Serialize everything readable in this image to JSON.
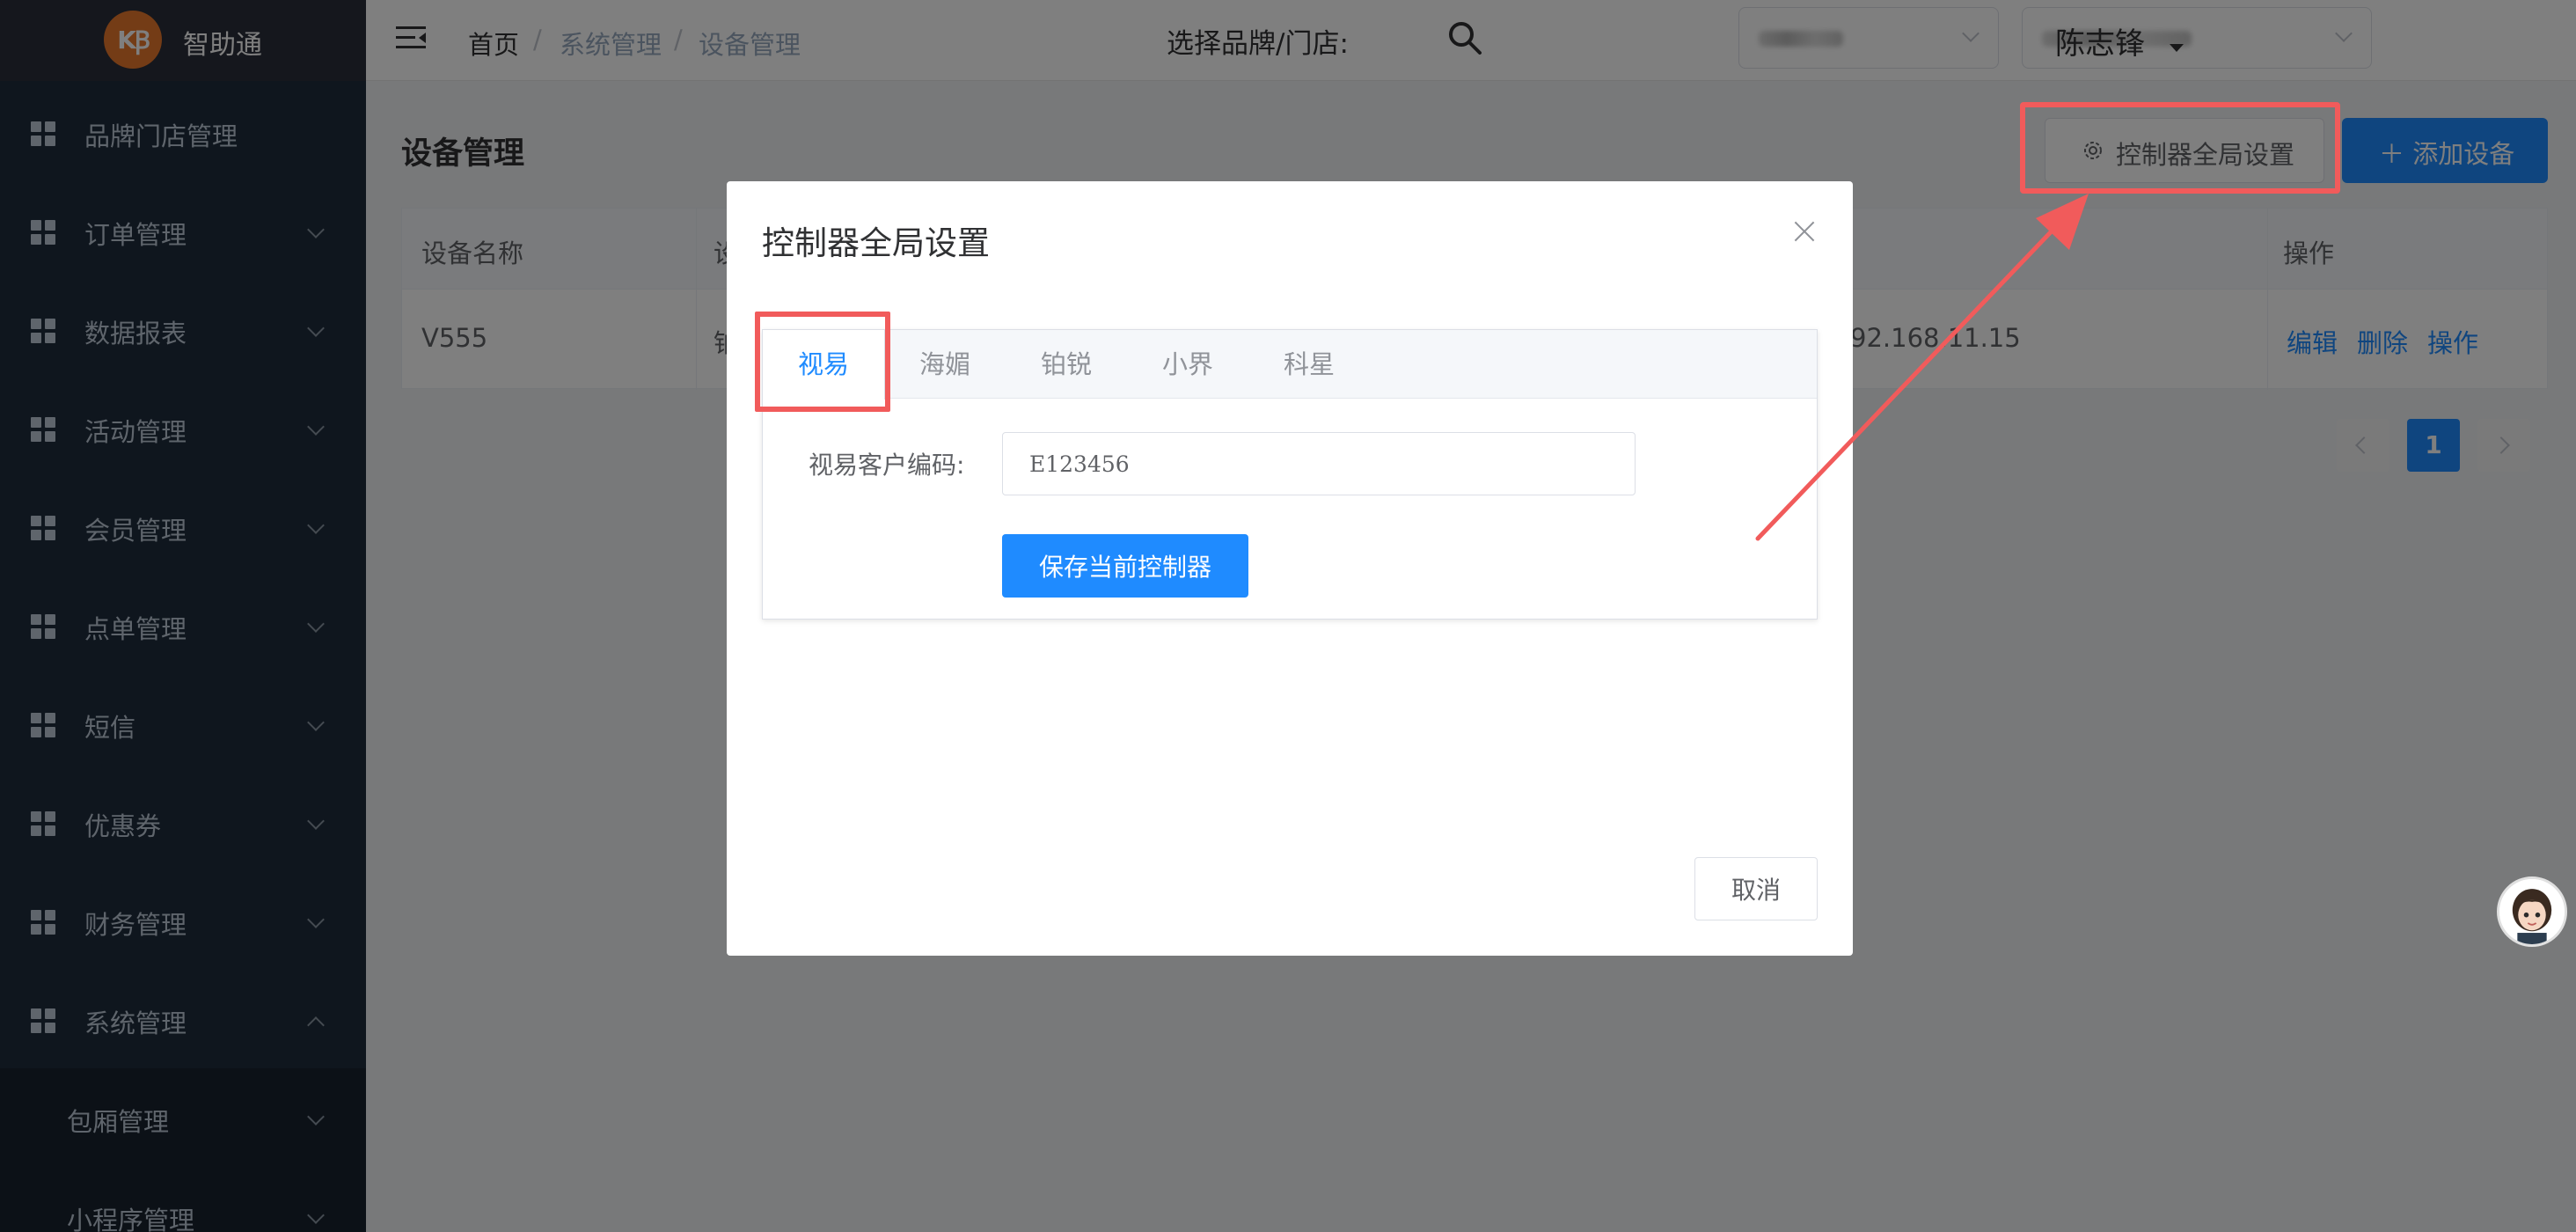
{
  "app": {
    "logo_text": "KꞴ",
    "name": "智助通"
  },
  "sidebar": {
    "items": [
      {
        "label": "品牌门店管理",
        "has_chevron": false
      },
      {
        "label": "订单管理",
        "has_chevron": true
      },
      {
        "label": "数据报表",
        "has_chevron": true
      },
      {
        "label": "活动管理",
        "has_chevron": true
      },
      {
        "label": "会员管理",
        "has_chevron": true
      },
      {
        "label": "点单管理",
        "has_chevron": true
      },
      {
        "label": "短信",
        "has_chevron": true
      },
      {
        "label": "优惠券",
        "has_chevron": true
      },
      {
        "label": "财务管理",
        "has_chevron": true
      },
      {
        "label": "系统管理",
        "has_chevron": true,
        "expanded": true
      }
    ],
    "sub_items": [
      {
        "label": "包厢管理"
      },
      {
        "label": "小程序管理"
      }
    ]
  },
  "header": {
    "breadcrumb": [
      "首页",
      "系统管理",
      "设备管理"
    ],
    "separator": "/",
    "brand_store_label": "选择品牌/门店:",
    "user_name": "陈志锋"
  },
  "main": {
    "title": "设备管理",
    "settings_button": "控制器全局设置",
    "add_button": "＋ 添加设备",
    "table": {
      "headers": [
        "设备名称",
        "设",
        "操作"
      ],
      "rows": [
        {
          "name": "V555",
          "col2": "铂",
          "ip": "92.168.11.15",
          "ops": [
            "编辑",
            "删除",
            "操作"
          ]
        }
      ]
    },
    "pagination": {
      "current": "1"
    }
  },
  "modal": {
    "title": "控制器全局设置",
    "tabs": [
      "视易",
      "海媚",
      "铂锐",
      "小界",
      "科星"
    ],
    "active_tab": 0,
    "field_label": "视易客户编码:",
    "field_value": "E123456",
    "save_button": "保存当前控制器",
    "cancel_button": "取消"
  },
  "colors": {
    "primary": "#1f8bff",
    "sidebar_bg": "#1f2d3d",
    "annotation_red": "#f15b5b",
    "logo_orange": "#e8792d"
  }
}
